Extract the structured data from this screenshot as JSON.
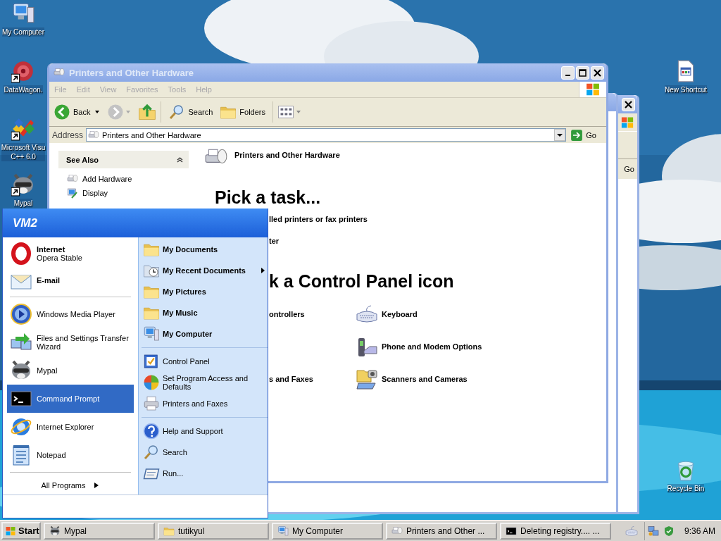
{
  "desktop_icons": [
    {
      "label": "My Computer"
    },
    {
      "label": "DataWagon."
    },
    {
      "label": "Microsoft Visu\nC++ 6.0"
    },
    {
      "label": "Mypal"
    },
    {
      "label": "New Shortcut"
    },
    {
      "label": "Recycle Bin"
    }
  ],
  "back_window": {
    "go": "Go"
  },
  "window": {
    "title": "Printers and Other Hardware",
    "active": false,
    "menu": [
      "File",
      "Edit",
      "View",
      "Favorites",
      "Tools",
      "Help"
    ],
    "toolbar": {
      "back": "Back",
      "search": "Search",
      "folders": "Folders"
    },
    "address": {
      "label": "Address",
      "value": "Printers and Other Hardware",
      "go": "Go"
    },
    "see_also": {
      "title": "See Also",
      "items": [
        "Add Hardware",
        "Display"
      ]
    },
    "header": "Printers and Other Hardware",
    "pick_task": "Pick a task...",
    "tasks": [
      "lled printers or fax printers",
      "ter"
    ],
    "pick_icon": "k a Control Panel icon",
    "icon_rows": [
      {
        "left": "ontrollers",
        "right": "Keyboard"
      },
      {
        "right": "Phone and Modem Options"
      },
      {
        "left": "s and Faxes",
        "right": "Scanners and Cameras"
      }
    ]
  },
  "start_menu": {
    "user": "VM2",
    "pinned": [
      {
        "title": "Internet",
        "subtitle": "Opera Stable"
      },
      {
        "title": "E-mail"
      }
    ],
    "programs": [
      {
        "label": "Windows Media Player",
        "selected": false
      },
      {
        "label": "Files and Settings Transfer Wizard",
        "selected": false
      },
      {
        "label": "Mypal",
        "selected": false
      },
      {
        "label": "Command Prompt",
        "selected": true
      },
      {
        "label": "Internet Explorer",
        "selected": false
      },
      {
        "label": "Notepad",
        "selected": false
      }
    ],
    "all_programs": "All Programs",
    "places": [
      "My Documents",
      "My Recent Documents",
      "My Pictures",
      "My Music",
      "My Computer"
    ],
    "settings": [
      "Control Panel",
      "Set Program Access and Defaults",
      "Printers and Faxes"
    ],
    "support": [
      "Help and Support",
      "Search",
      "Run..."
    ]
  },
  "taskbar": {
    "start": "Start",
    "tasks": [
      "Mypal",
      "tutikyul",
      "My Computer",
      "Printers and Other ...",
      "Deleting registry.... ..."
    ],
    "clock": "9:36 AM"
  }
}
